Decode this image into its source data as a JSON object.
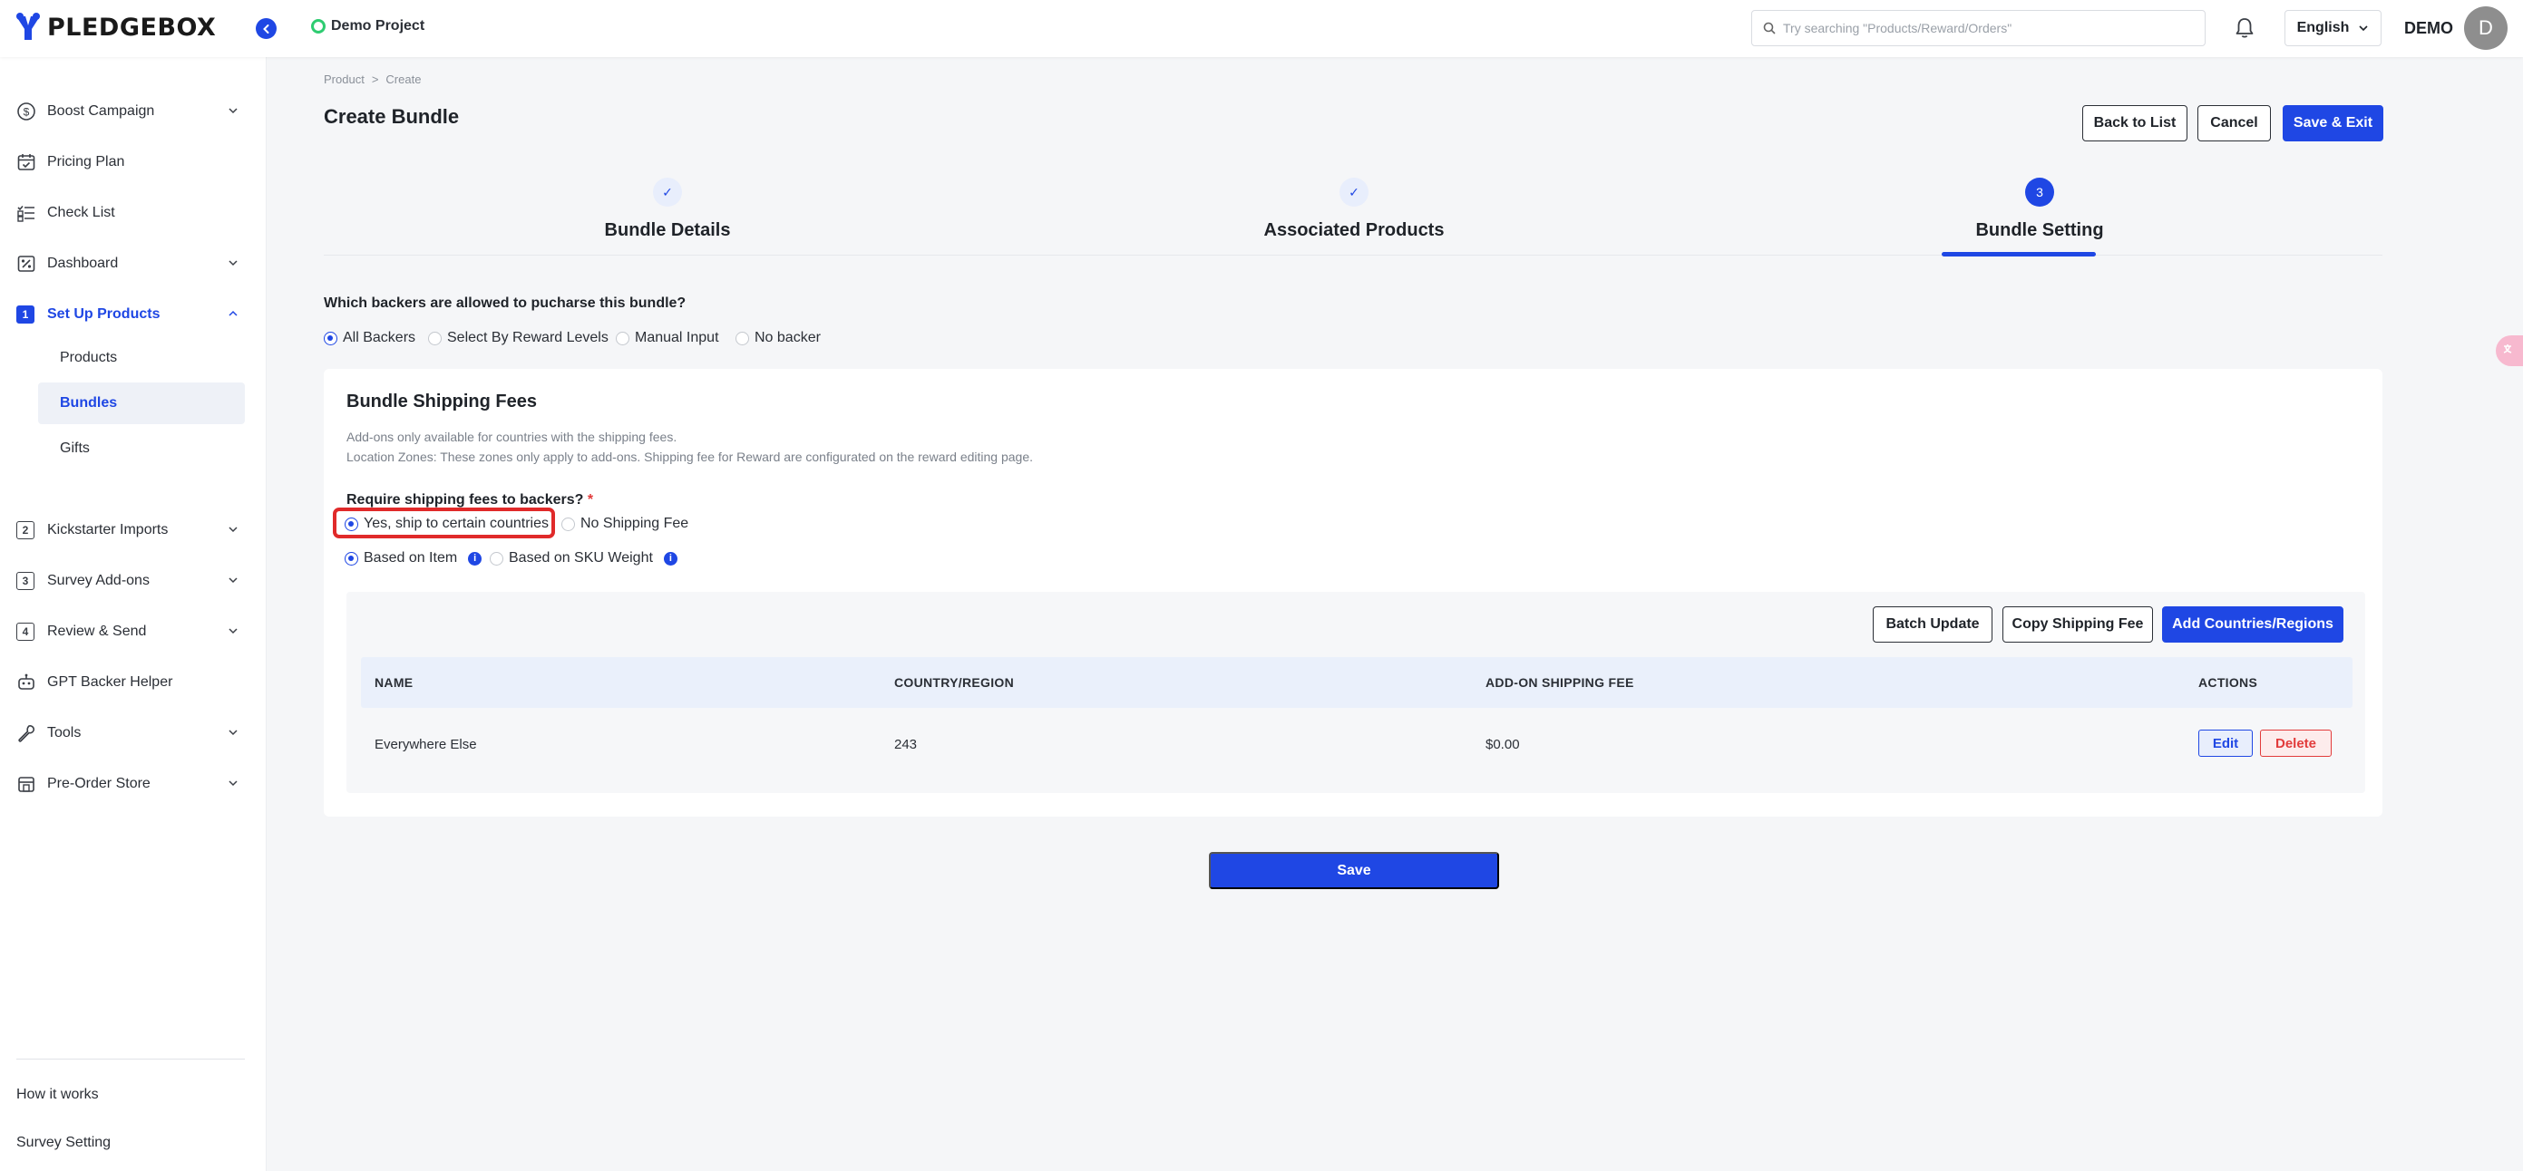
{
  "header": {
    "logo_text": "PLEDGEBOX",
    "project_name": "Demo Project",
    "search_placeholder": "Try searching \"Products/Reward/Orders\"",
    "language": "English",
    "user_name": "DEMO",
    "avatar_initial": "D",
    "brand_color": "#1f47e4"
  },
  "sidebar": {
    "items": [
      {
        "label": "Boost Campaign",
        "icon": "dollar-circle-icon",
        "expandable": true
      },
      {
        "label": "Pricing Plan",
        "icon": "calendar-check-icon",
        "expandable": false
      },
      {
        "label": "Check List",
        "icon": "checklist-icon",
        "expandable": false
      },
      {
        "label": "Dashboard",
        "icon": "percent-chart-icon",
        "expandable": true
      },
      {
        "label": "Set Up Products",
        "number": "1",
        "expandable": true,
        "expanded": true
      },
      {
        "label": "Kickstarter Imports",
        "number": "2",
        "expandable": true
      },
      {
        "label": "Survey Add-ons",
        "number": "3",
        "expandable": true
      },
      {
        "label": "Review & Send",
        "number": "4",
        "expandable": true
      },
      {
        "label": "GPT Backer Helper",
        "icon": "robot-icon",
        "expandable": false
      },
      {
        "label": "Tools",
        "icon": "wrench-icon",
        "expandable": true
      },
      {
        "label": "Pre-Order Store",
        "icon": "store-icon",
        "expandable": true
      }
    ],
    "sub_items": [
      {
        "label": "Products"
      },
      {
        "label": "Bundles",
        "active": true
      },
      {
        "label": "Gifts"
      }
    ],
    "footer": {
      "how_it_works": "How it works",
      "survey_setting": "Survey Setting"
    }
  },
  "breadcrumb": {
    "root": "Product",
    "separator": ">",
    "current": "Create"
  },
  "page": {
    "title": "Create Bundle",
    "back_label": "Back to List",
    "cancel_label": "Cancel",
    "save_exit_label": "Save & Exit"
  },
  "steps": [
    {
      "label": "Bundle Details",
      "status": "done",
      "marker": "✓"
    },
    {
      "label": "Associated Products",
      "status": "done",
      "marker": "✓"
    },
    {
      "label": "Bundle Setting",
      "status": "current",
      "marker": "3"
    }
  ],
  "backers": {
    "question": "Which backers are allowed to pucharse this bundle?",
    "options": [
      "All Backers",
      "Select By Reward Levels",
      "Manual Input",
      "No backer"
    ],
    "selected": "All Backers"
  },
  "shipping": {
    "title": "Bundle Shipping Fees",
    "desc1": "Add-ons only available for countries with the shipping fees.",
    "desc2": "Location Zones: These zones only apply to add-ons. Shipping fee for Reward are configurated on the reward editing page.",
    "require_label": "Require shipping fees to backers?",
    "require_star": "*",
    "require_options": [
      "Yes, ship to certain countries",
      "No Shipping Fee"
    ],
    "require_selected": "Yes, ship to certain countries",
    "basis_options": [
      "Based on Item",
      "Based on SKU Weight"
    ],
    "basis_selected": "Based on Item",
    "info_glyph": "i",
    "batch_update_label": "Batch Update",
    "copy_fee_label": "Copy Shipping Fee",
    "add_countries_label": "Add Countries/Regions",
    "columns": [
      "NAME",
      "COUNTRY/REGION",
      "ADD-ON SHIPPING FEE",
      "ACTIONS"
    ],
    "rows": [
      {
        "name": "Everywhere Else",
        "country_count": "243",
        "fee": "$0.00"
      }
    ],
    "edit_label": "Edit",
    "delete_label": "Delete"
  },
  "save_label": "Save"
}
